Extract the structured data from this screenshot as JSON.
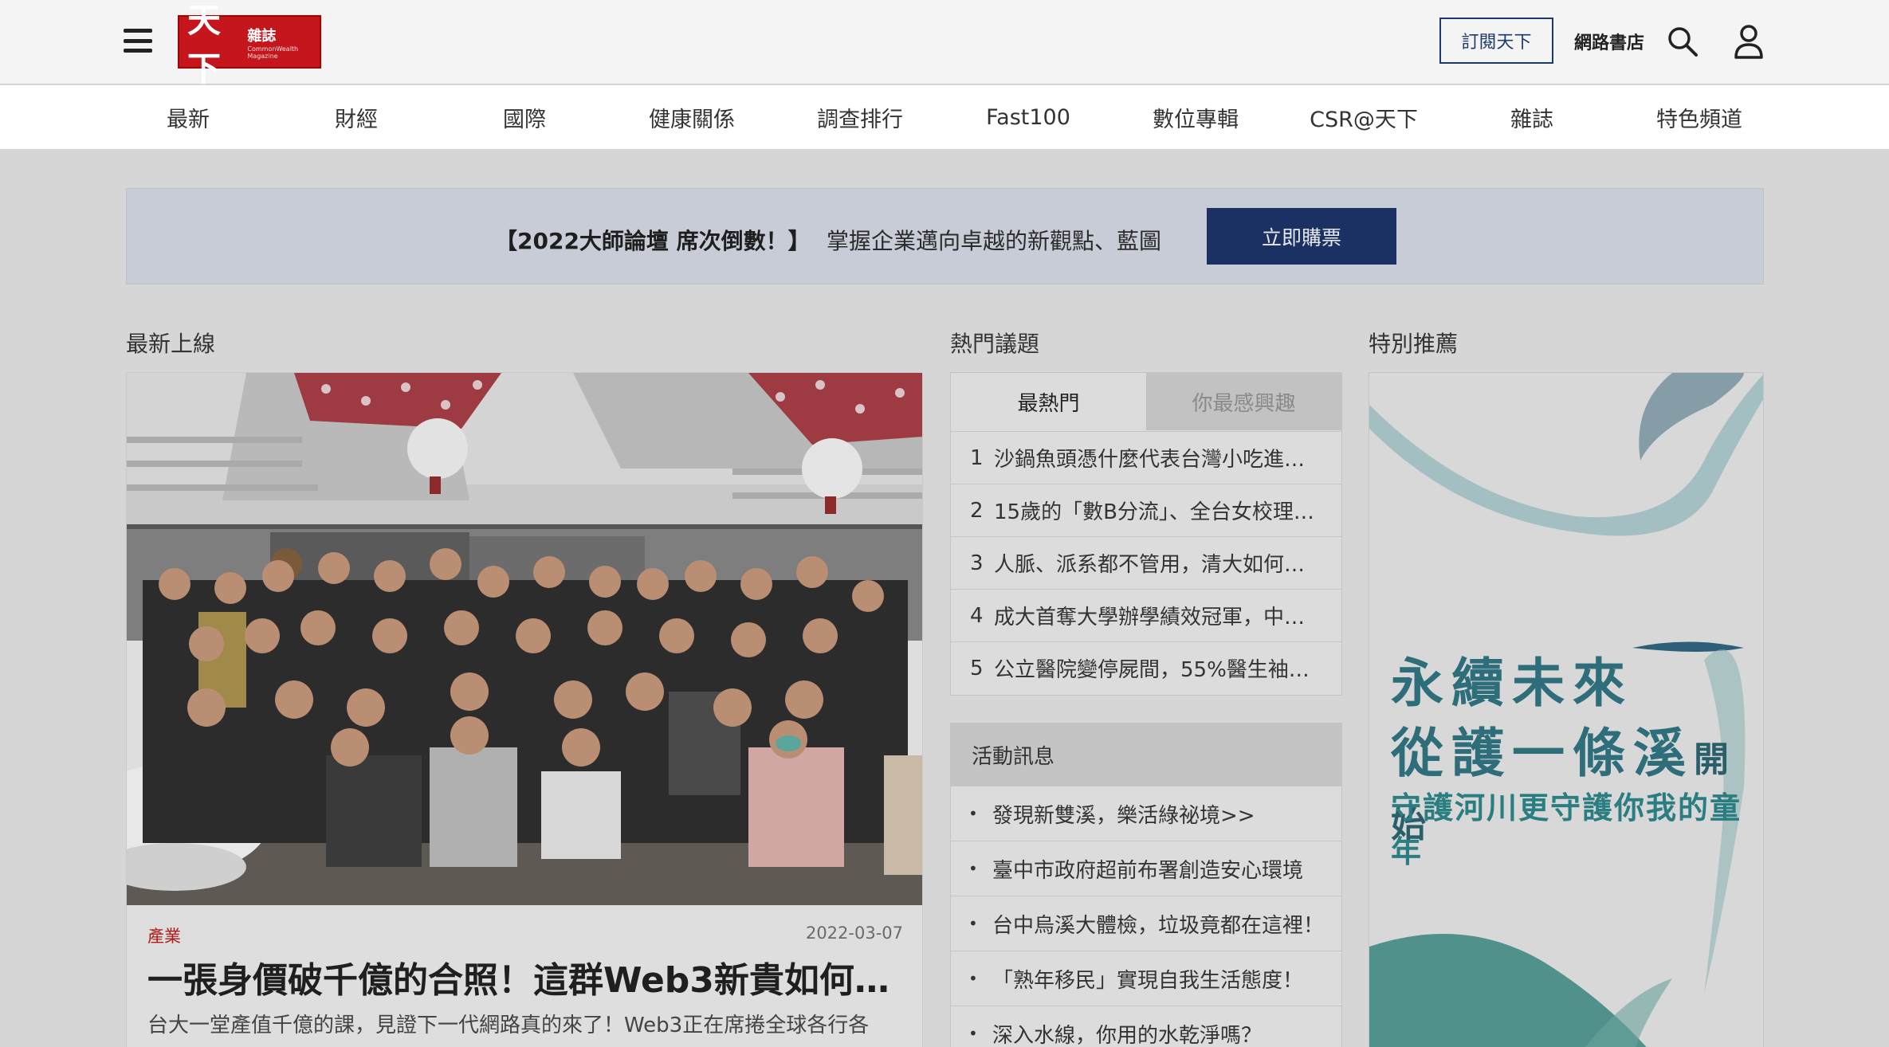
{
  "header": {
    "logo_main": "天下",
    "logo_sub": "雜誌",
    "logo_en": "CommonWealth Magazine",
    "subscribe_label": "訂閱天下",
    "bookstore_label": "網路書店"
  },
  "nav": {
    "items": [
      "最新",
      "財經",
      "國際",
      "健康關係",
      "調查排行",
      "Fast100",
      "數位專輯",
      "CSR@天下",
      "雜誌",
      "特色頻道"
    ]
  },
  "banner": {
    "title": "【2022大師論壇 席次倒數！】",
    "text": "掌握企業邁向卓越的新觀點、藍圖",
    "button_label": "立即購票"
  },
  "latest": {
    "heading": "最新上線",
    "article": {
      "category": "產業",
      "date": "2022-03-07",
      "title": "一張身價破千億的合照！這群Web3新貴如何…",
      "excerpt": "台大一堂產值千億的課，見證下一代網路真的來了！Web3正在席捲全球各行各"
    }
  },
  "hot": {
    "heading": "熱門議題",
    "tab_active": "最熱門",
    "tab_inactive": "你最感興趣",
    "items": [
      {
        "num": "1",
        "text": "沙鍋魚頭憑什麼代表台灣小吃進…"
      },
      {
        "num": "2",
        "text": "15歲的「數B分流」、全台女校理…"
      },
      {
        "num": "3",
        "text": "人脈、派系都不管用，清大如何…"
      },
      {
        "num": "4",
        "text": "成大首奪大學辦學績效冠軍，中…"
      },
      {
        "num": "5",
        "text": "公立醫院變停屍間，55%醫生袖手…"
      }
    ]
  },
  "events": {
    "heading": "活動訊息",
    "items": [
      "發現新雙溪，樂活綠祕境>>",
      "臺中市政府超前布署創造安心環境",
      "台中烏溪大體檢，垃圾竟都在這裡！",
      "「熟年移民」實現自我生活態度！",
      "深入水線，你用的水乾淨嗎？"
    ]
  },
  "special": {
    "heading": "特別推薦",
    "promo_line1": "永續未來",
    "promo_line2": "從護一條溪",
    "promo_line2_small": "開始",
    "promo_line3": "守護河川更守護你我的童年"
  },
  "colors": {
    "brand_red": "#c4161c",
    "accent_navy": "#1c3163",
    "promo_teal": "#2d6e7a"
  }
}
